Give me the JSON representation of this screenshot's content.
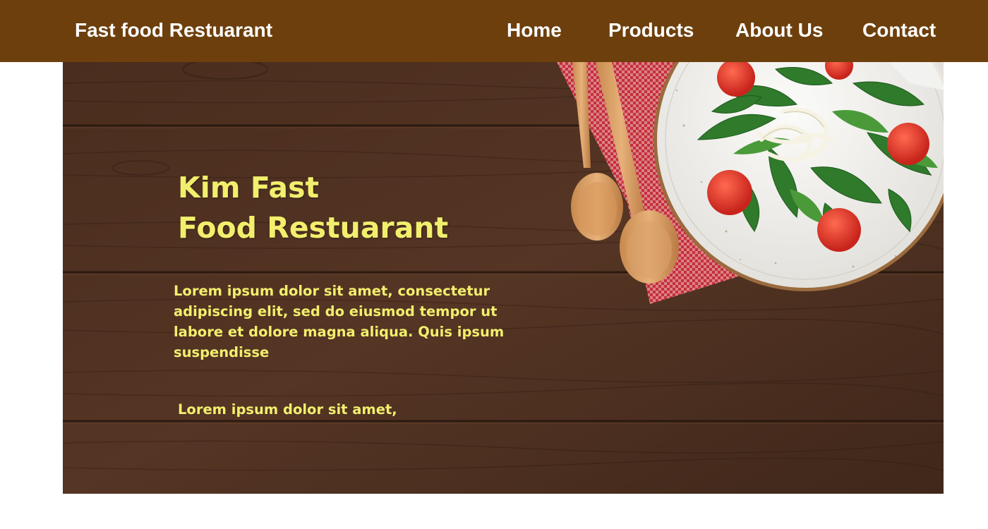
{
  "header": {
    "brand": "Fast food Restuarant",
    "nav": [
      "Home",
      "Products",
      "About Us",
      "Contact"
    ]
  },
  "hero": {
    "title_line1": "Kim Fast",
    "title_line2": "Food Restuarant",
    "description": "Lorem ipsum dolor sit amet, consectetur adipiscing elit, sed do eiusmod tempor ut labore et dolore magna aliqua. Quis ipsum suspendisse",
    "subtext": "Lorem ipsum dolor sit amet,"
  },
  "colors": {
    "nav_background": "#6d3f0c",
    "nav_text": "#ffffff",
    "hero_text": "#f2ef6d",
    "wood": "#4e3020",
    "napkin_red": "#d1323d"
  },
  "images": {
    "hero_background": "wooden-table-with-salad-plate-spoons-and-checkered-napkin"
  }
}
